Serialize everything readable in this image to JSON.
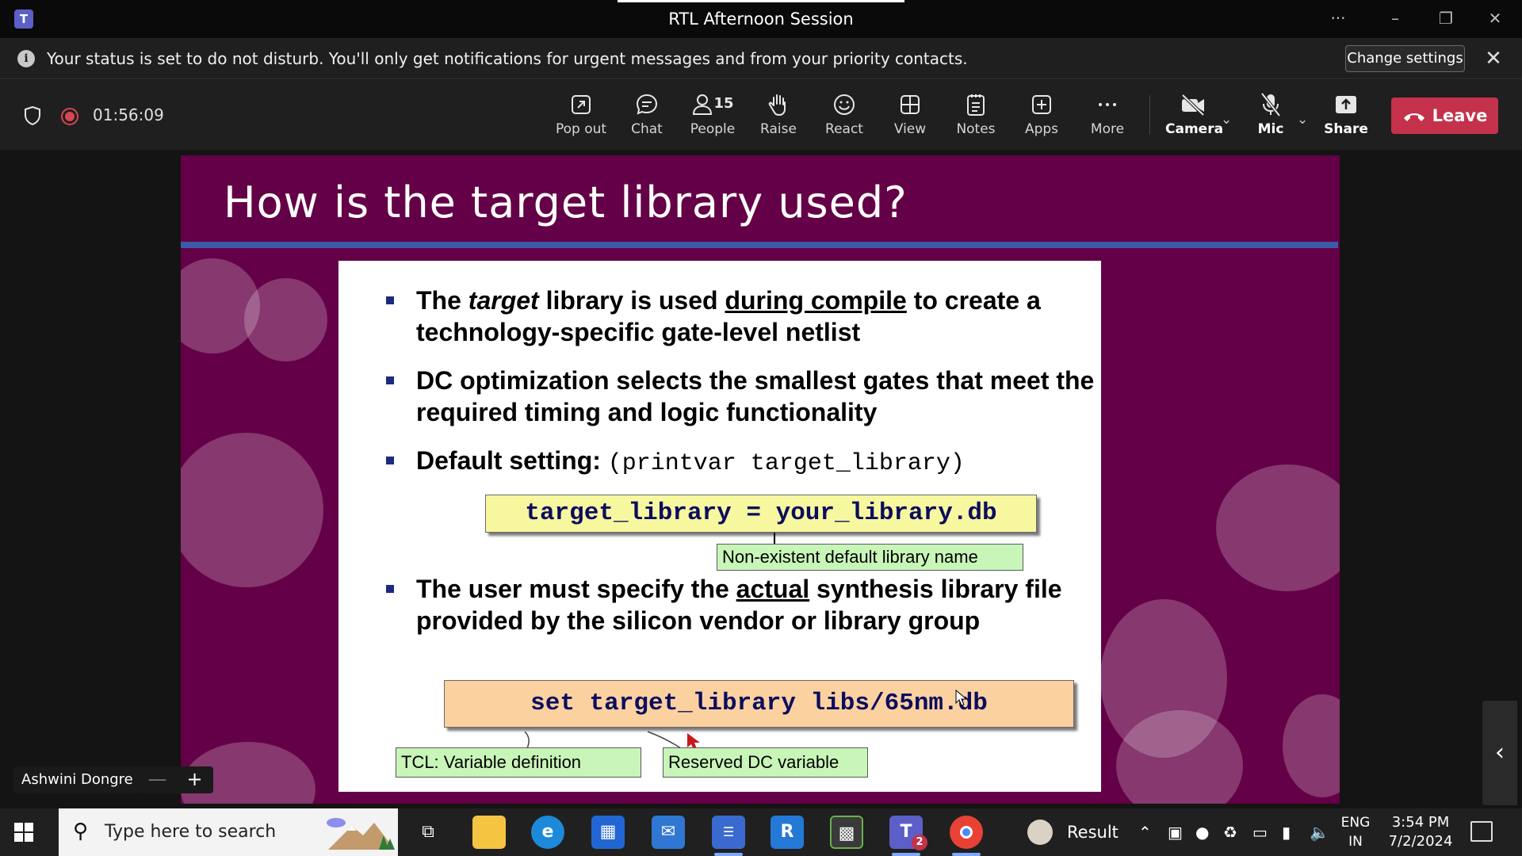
{
  "window": {
    "title": "RTL Afternoon Session",
    "more_label": "···",
    "minimize_label": "–",
    "restore_label": "❐",
    "close_label": "✕"
  },
  "notification": {
    "info_glyph": "i",
    "message": "Your status is set to do not disturb. You'll only get notifications for urgent messages and from your priority contacts.",
    "button": "Change settings",
    "close_glyph": "✕"
  },
  "meeting": {
    "elapsed": "01:56:09",
    "people_count": "15",
    "toolbar": [
      {
        "label": "Pop out",
        "icon": "pop-out-icon"
      },
      {
        "label": "Chat",
        "icon": "chat-icon"
      },
      {
        "label": "People",
        "icon": "people-icon"
      },
      {
        "label": "Raise",
        "icon": "raise-hand-icon"
      },
      {
        "label": "React",
        "icon": "react-icon"
      },
      {
        "label": "View",
        "icon": "view-icon"
      },
      {
        "label": "Notes",
        "icon": "notes-icon"
      },
      {
        "label": "Apps",
        "icon": "apps-icon"
      },
      {
        "label": "More",
        "icon": "more-icon"
      },
      {
        "label": "Camera",
        "icon": "camera-off-icon"
      },
      {
        "label": "Mic",
        "icon": "mic-off-icon"
      },
      {
        "label": "Share",
        "icon": "share-icon"
      }
    ],
    "leave": "Leave",
    "presenter": "Ashwini Dongre",
    "zoom_out": "—",
    "zoom_in": "+"
  },
  "slide": {
    "title": "How is the target library used?",
    "b1_part1": "The ",
    "b1_italic": "target",
    "b1_part2": " library is used ",
    "b1_under": "during compile",
    "b1_part3": " to create a technology-specific gate-level netlist",
    "b2": "DC optimization selects the smallest gates that meet the required timing and logic functionality",
    "b3_label": "Default setting: ",
    "b3_code": "(printvar target_library)",
    "code1": "target_library = your_library.db",
    "note1": "Non-existent default library name",
    "b4_part1": "The user must specify the ",
    "b4_under": "actual",
    "b4_part2": " synthesis library file provided by the silicon vendor or library group",
    "code2": "set target_library libs/65nm.db",
    "note2": "TCL: Variable definition",
    "note3": "Reserved DC variable"
  },
  "taskbar": {
    "search_placeholder": "Type here to search",
    "result_label": "Result",
    "lang_top": "ENG",
    "lang_bottom": "IN",
    "time": "3:54 PM",
    "date": "7/2/2024",
    "teams_badge": "2"
  },
  "colors": {
    "slide_bg": "#640047",
    "title_rule": "#3c5aa8",
    "leave_red": "#c4314b",
    "code1_bg": "#f7f7a0",
    "code2_bg": "#fcd1a0",
    "note_bg": "#c8f5b8"
  }
}
